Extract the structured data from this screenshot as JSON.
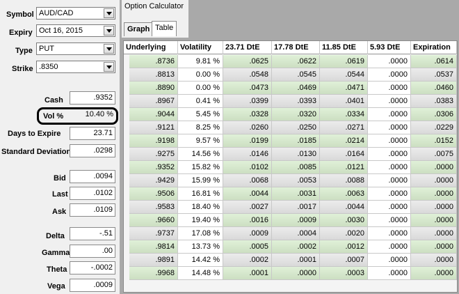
{
  "inputs": {
    "symbol_label": "Symbol",
    "symbol_value": "AUD/CAD",
    "expiry_label": "Expiry",
    "expiry_value": "Oct 16, 2015",
    "type_label": "Type",
    "type_value": "PUT",
    "strike_label": "Strike",
    "strike_value": ".8350"
  },
  "stats": {
    "cash_label": "Cash",
    "cash_value": ".9352",
    "vol_label": "Vol %",
    "vol_value": "10.40 %",
    "days_label": "Days to Expire",
    "days_value": "23.71",
    "sd_label": "Standard Deviation",
    "sd_value": ".0298",
    "bid_label": "Bid",
    "bid_value": ".0094",
    "last_label": "Last",
    "last_value": ".0102",
    "ask_label": "Ask",
    "ask_value": ".0109",
    "delta_label": "Delta",
    "delta_value": "-.51",
    "gamma_label": "Gamma",
    "gamma_value": ".00",
    "theta_label": "Theta",
    "theta_value": "-.0002",
    "vega_label": "Vega",
    "vega_value": ".0009"
  },
  "panel": {
    "title": "Option Calculator",
    "tab_graph": "Graph",
    "tab_table": "Table"
  },
  "table": {
    "columns": [
      "Underlying",
      "Volatility",
      "23.71 DtE",
      "17.78 DtE",
      "11.85 DtE",
      "5.93 DtE",
      "Expiration"
    ],
    "rows": [
      [
        ".8736",
        "9.81 %",
        ".0625",
        ".0622",
        ".0619",
        ".0000",
        ".0614"
      ],
      [
        ".8813",
        "0.00 %",
        ".0548",
        ".0545",
        ".0544",
        ".0000",
        ".0537"
      ],
      [
        ".8890",
        "0.00 %",
        ".0473",
        ".0469",
        ".0471",
        ".0000",
        ".0460"
      ],
      [
        ".8967",
        "0.41 %",
        ".0399",
        ".0393",
        ".0401",
        ".0000",
        ".0383"
      ],
      [
        ".9044",
        "5.45 %",
        ".0328",
        ".0320",
        ".0334",
        ".0000",
        ".0306"
      ],
      [
        ".9121",
        "8.25 %",
        ".0260",
        ".0250",
        ".0271",
        ".0000",
        ".0229"
      ],
      [
        ".9198",
        "9.57 %",
        ".0199",
        ".0185",
        ".0214",
        ".0000",
        ".0152"
      ],
      [
        ".9275",
        "14.56 %",
        ".0146",
        ".0130",
        ".0164",
        ".0000",
        ".0075"
      ],
      [
        ".9352",
        "15.82 %",
        ".0102",
        ".0085",
        ".0121",
        ".0000",
        ".0000"
      ],
      [
        ".9429",
        "15.99 %",
        ".0068",
        ".0053",
        ".0088",
        ".0000",
        ".0000"
      ],
      [
        ".9506",
        "16.81 %",
        ".0044",
        ".0031",
        ".0063",
        ".0000",
        ".0000"
      ],
      [
        ".9583",
        "18.40 %",
        ".0027",
        ".0017",
        ".0044",
        ".0000",
        ".0000"
      ],
      [
        ".9660",
        "19.40 %",
        ".0016",
        ".0009",
        ".0030",
        ".0000",
        ".0000"
      ],
      [
        ".9737",
        "17.08 %",
        ".0009",
        ".0004",
        ".0020",
        ".0000",
        ".0000"
      ],
      [
        ".9814",
        "13.73 %",
        ".0005",
        ".0002",
        ".0012",
        ".0000",
        ".0000"
      ],
      [
        ".9891",
        "14.42 %",
        ".0002",
        ".0001",
        ".0007",
        ".0000",
        ".0000"
      ],
      [
        ".9968",
        "14.48 %",
        ".0001",
        ".0000",
        ".0003",
        ".0000",
        ".0000"
      ]
    ]
  },
  "colors": {
    "green_row": "#d5e8cc",
    "gray_row": "#e2e2e2",
    "background": "#a9a9a9"
  }
}
